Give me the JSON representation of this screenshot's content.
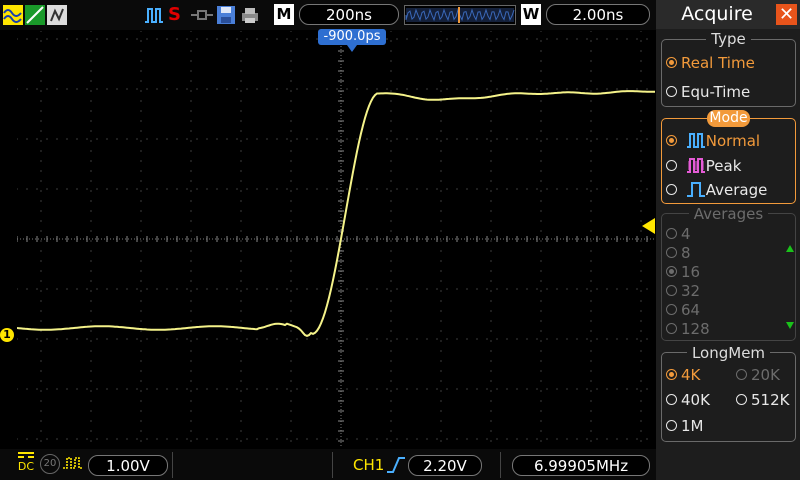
{
  "top_bar": {
    "trigger_status": "S",
    "mode_label": "M",
    "timebase": "200ns",
    "window_label": "W",
    "window_value": "2.00ns",
    "trigger_offset": "-900.0ps",
    "icons": [
      "waveform-icon",
      "cursor-icon",
      "print-icon",
      "acquire-normal-icon",
      "probe-icon",
      "save-icon",
      "printer-icon"
    ]
  },
  "bottom_bar": {
    "coupling": "DC",
    "bandwidth_limit": "20",
    "ch1_scale": "1.00V",
    "trigger_source": "CH1",
    "trigger_level": "2.20V",
    "frequency": "6.99905MHz"
  },
  "channel_marker": "1",
  "panel": {
    "title": "Acquire",
    "type": {
      "title": "Type",
      "options": [
        {
          "label": "Real Time",
          "selected": true
        },
        {
          "label": "Equ-Time",
          "selected": false
        }
      ]
    },
    "mode": {
      "title": "Mode",
      "options": [
        {
          "label": "Normal",
          "selected": true
        },
        {
          "label": "Peak",
          "selected": false
        },
        {
          "label": "Average",
          "selected": false
        }
      ]
    },
    "averages": {
      "title": "Averages",
      "options": [
        "4",
        "8",
        "16",
        "32",
        "64",
        "128"
      ],
      "selected": "16"
    },
    "longmem": {
      "title": "LongMem",
      "options": [
        "4K",
        "20K",
        "40K",
        "512K",
        "1M"
      ],
      "selected": "4K"
    }
  },
  "colors": {
    "trace": "#f5f38a",
    "accent": "#f29a3b",
    "marker_yellow": "#ffe600",
    "trigger_blue": "#2e6fd1",
    "grid": "#7a7a7a"
  }
}
